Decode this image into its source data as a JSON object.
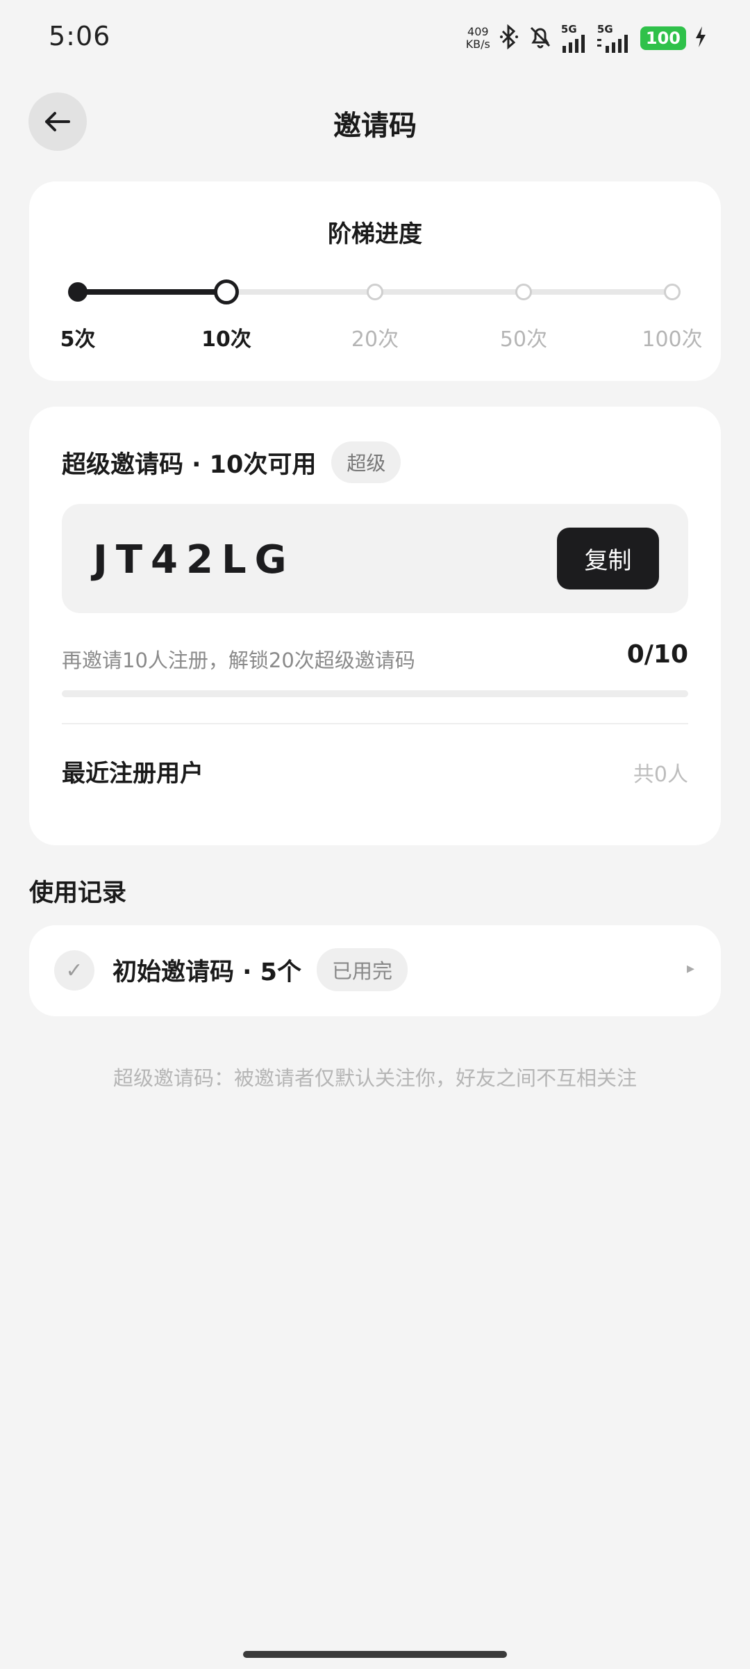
{
  "status_bar": {
    "time": "5:06",
    "net_speed_value": "409",
    "net_speed_unit": "KB/s",
    "sim1_label": "5G",
    "sim2_label": "5G",
    "battery": "100"
  },
  "header": {
    "title": "邀请码"
  },
  "progress": {
    "title": "阶梯进度",
    "steps": [
      {
        "label": "5次",
        "state": "done"
      },
      {
        "label": "10次",
        "state": "current"
      },
      {
        "label": "20次",
        "state": "pending"
      },
      {
        "label": "50次",
        "state": "pending"
      },
      {
        "label": "100次",
        "state": "pending"
      }
    ],
    "current_index": 1
  },
  "invite": {
    "title": "超级邀请码 · 10次可用",
    "tag": "超级",
    "code": "JT42LG",
    "copy_label": "复制",
    "hint": "再邀请10人注册，解锁20次超级邀请码",
    "count": "0/10",
    "progress_fraction": 0,
    "recent_label": "最近注册用户",
    "recent_count": "共0人"
  },
  "usage": {
    "section_title": "使用记录",
    "item_text": "初始邀请码 · 5个",
    "item_tag": "已用完",
    "check_glyph": "✓",
    "chevron_glyph": "▸"
  },
  "footnote": "超级邀请码：被邀请者仅默认关注你，好友之间不互相关注"
}
